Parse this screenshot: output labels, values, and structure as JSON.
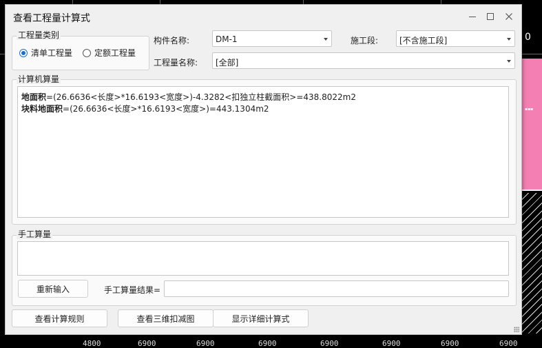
{
  "window": {
    "title": "查看工程量计算式"
  },
  "quantity_type": {
    "group_label": "工程量类别",
    "options": [
      {
        "label": "清单工程量",
        "selected": true
      },
      {
        "label": "定额工程量",
        "selected": false
      }
    ]
  },
  "component": {
    "label": "构件名称:",
    "value": "DM-1"
  },
  "construction_section": {
    "label": "施工段:",
    "value": "[不含施工段]"
  },
  "quantity_name": {
    "label": "工程量名称:",
    "value": "[全部]"
  },
  "computer_calc": {
    "group_label": "计算机算量",
    "lines": [
      {
        "name": "地面积",
        "expr": "=(26.6636<长度>*16.6193<宽度>)-4.3282<扣独立柱截面积>=438.8022m2"
      },
      {
        "name": "块料地面积",
        "expr": "=(26.6636<长度>*16.6193<宽度>)=443.1304m2"
      }
    ]
  },
  "manual_calc": {
    "group_label": "手工算量",
    "reinput_button": "重新输入",
    "result_label": "手工算量结果=",
    "result_value": ""
  },
  "footer_buttons": {
    "rules": "查看计算规则",
    "view_3d": "查看三维扣减图",
    "detail": "显示详细计算式"
  },
  "background": {
    "ruler_numbers": [
      "4800",
      "6900",
      "6900",
      "6900",
      "6900",
      "6900",
      "6900",
      "6900"
    ],
    "top_right_text": "0",
    "accent_pink": "#f47fb2"
  }
}
